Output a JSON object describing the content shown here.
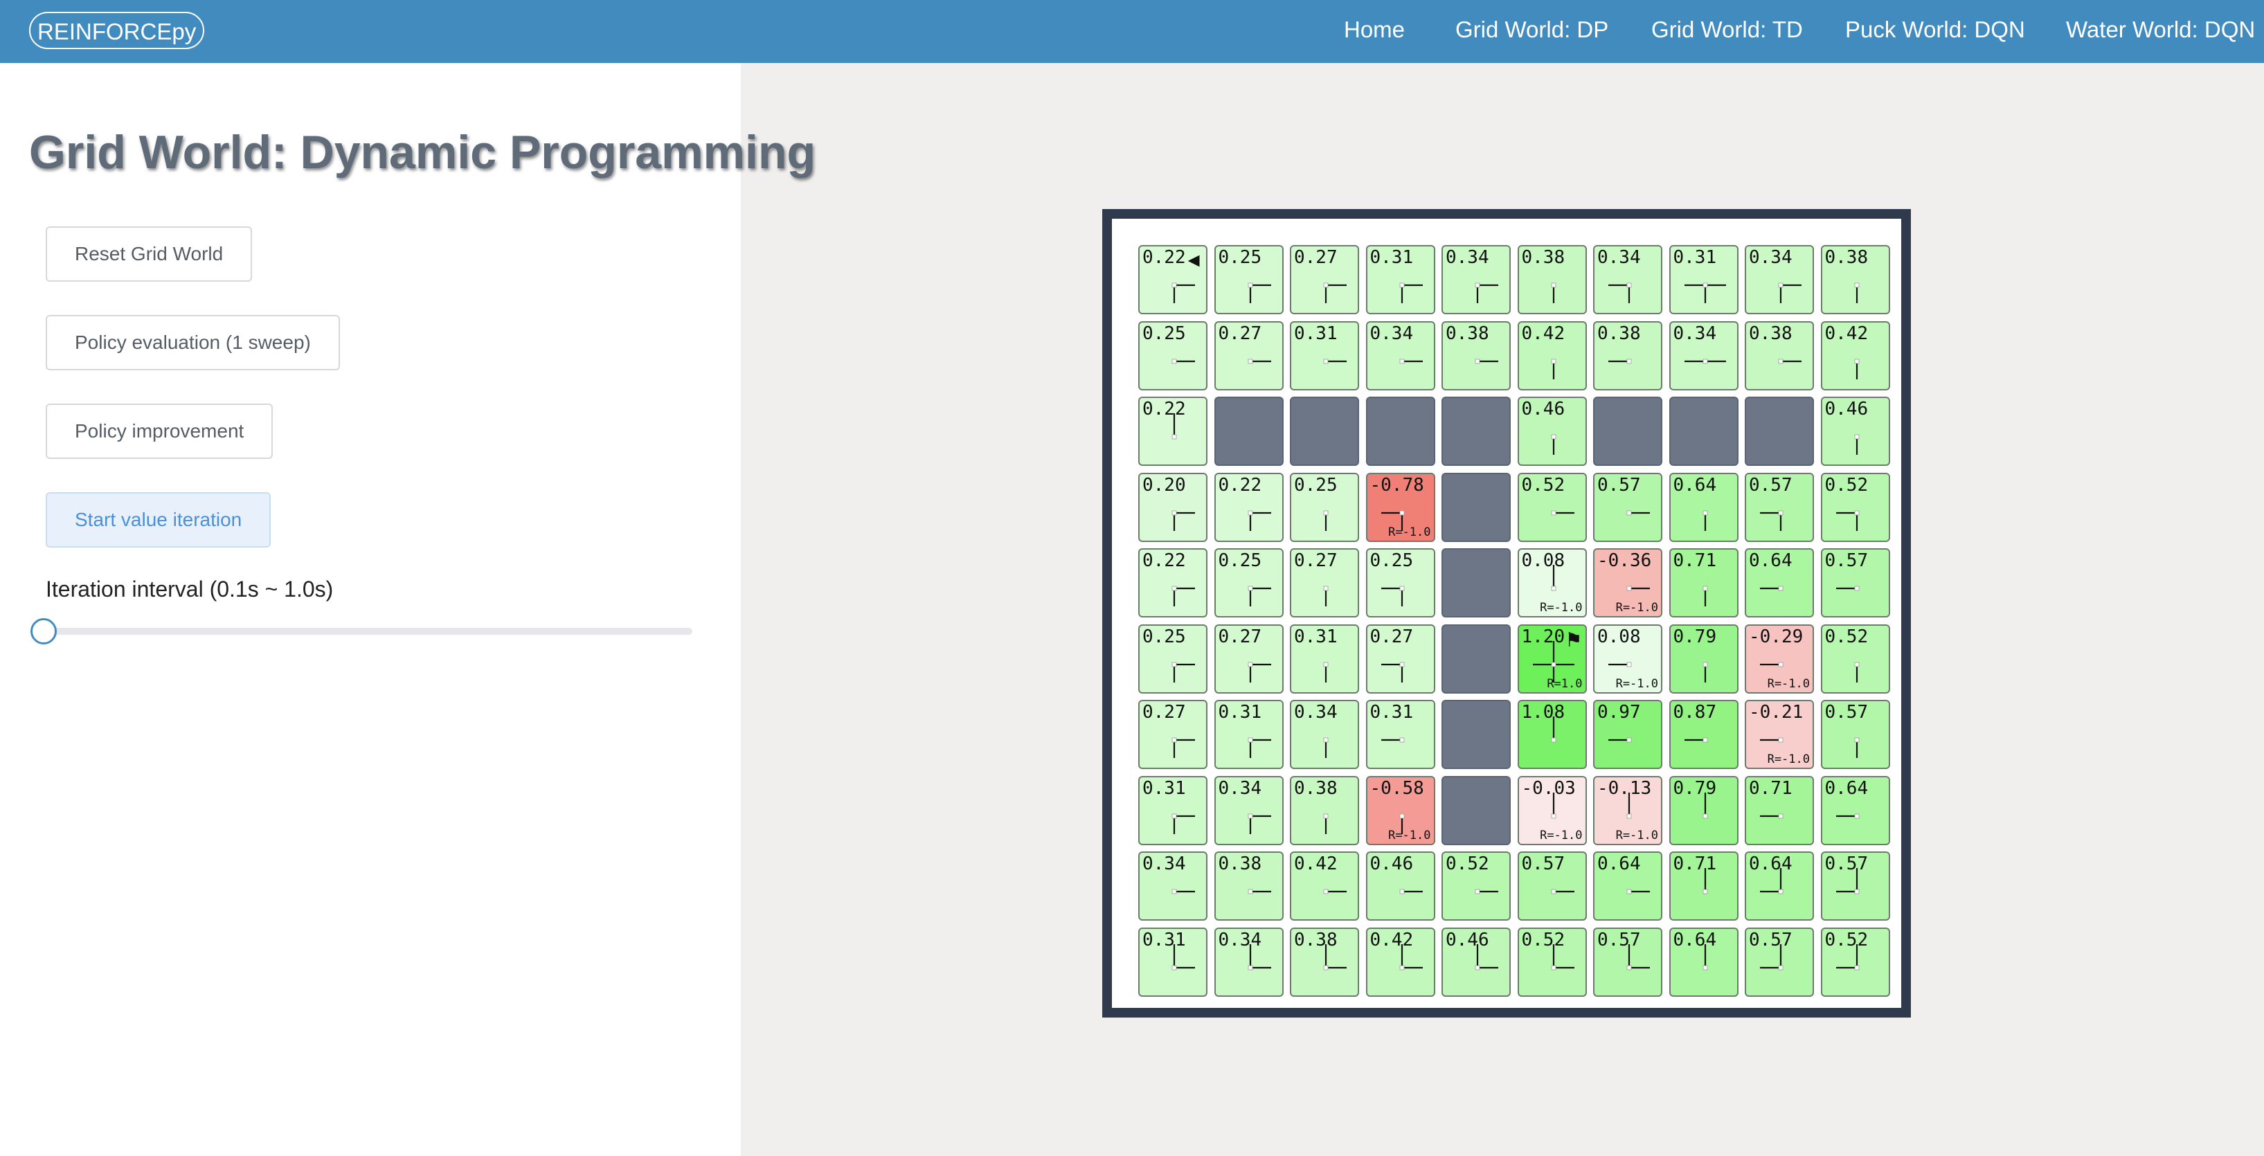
{
  "brand": "REINFORCEpy",
  "nav": [
    "Home",
    "Grid World: DP",
    "Grid World: TD",
    "Puck World: DQN",
    "Water World: DQN"
  ],
  "title": "Grid World: Dynamic Programming",
  "buttons": [
    "Reset Grid World",
    "Policy evaluation (1 sweep)",
    "Policy improvement",
    "Start value iteration"
  ],
  "interval_label": "Iteration interval (0.1s ~ 1.0s)",
  "slider_value": 0.1,
  "agent_icon": "agent-icon",
  "goal_icon": "goal-flag-icon",
  "grid": [
    [
      {
        "v": "0.22",
        "p": "ES",
        "agent": true
      },
      {
        "v": "0.25",
        "p": "ES"
      },
      {
        "v": "0.27",
        "p": "ES"
      },
      {
        "v": "0.31",
        "p": "ES"
      },
      {
        "v": "0.34",
        "p": "ES"
      },
      {
        "v": "0.38",
        "p": "S"
      },
      {
        "v": "0.34",
        "p": "WS"
      },
      {
        "v": "0.31",
        "p": "EWS"
      },
      {
        "v": "0.34",
        "p": "ES"
      },
      {
        "v": "0.38",
        "p": "S"
      }
    ],
    [
      {
        "v": "0.25",
        "p": "E"
      },
      {
        "v": "0.27",
        "p": "E"
      },
      {
        "v": "0.31",
        "p": "E"
      },
      {
        "v": "0.34",
        "p": "E"
      },
      {
        "v": "0.38",
        "p": "E"
      },
      {
        "v": "0.42",
        "p": "S"
      },
      {
        "v": "0.38",
        "p": "W"
      },
      {
        "v": "0.34",
        "p": "EW"
      },
      {
        "v": "0.38",
        "p": "E"
      },
      {
        "v": "0.42",
        "p": "S"
      }
    ],
    [
      {
        "v": "0.22",
        "p": "N"
      },
      {
        "wall": true
      },
      {
        "wall": true
      },
      {
        "wall": true
      },
      {
        "wall": true
      },
      {
        "v": "0.46",
        "p": "S"
      },
      {
        "wall": true
      },
      {
        "wall": true
      },
      {
        "wall": true
      },
      {
        "v": "0.46",
        "p": "S"
      }
    ],
    [
      {
        "v": "0.20",
        "p": "ES"
      },
      {
        "v": "0.22",
        "p": "ES"
      },
      {
        "v": "0.25",
        "p": "S"
      },
      {
        "v": "-0.78",
        "p": "WS",
        "r": "R=-1.0"
      },
      {
        "wall": true
      },
      {
        "v": "0.52",
        "p": "E"
      },
      {
        "v": "0.57",
        "p": "E"
      },
      {
        "v": "0.64",
        "p": "S"
      },
      {
        "v": "0.57",
        "p": "WS"
      },
      {
        "v": "0.52",
        "p": "WS"
      }
    ],
    [
      {
        "v": "0.22",
        "p": "ES"
      },
      {
        "v": "0.25",
        "p": "ES"
      },
      {
        "v": "0.27",
        "p": "S"
      },
      {
        "v": "0.25",
        "p": "WS"
      },
      {
        "wall": true
      },
      {
        "v": "0.08",
        "p": "N",
        "r": "R=-1.0"
      },
      {
        "v": "-0.36",
        "p": "E",
        "r": "R=-1.0"
      },
      {
        "v": "0.71",
        "p": "S"
      },
      {
        "v": "0.64",
        "p": "W"
      },
      {
        "v": "0.57",
        "p": "W"
      }
    ],
    [
      {
        "v": "0.25",
        "p": "ES"
      },
      {
        "v": "0.27",
        "p": "ES"
      },
      {
        "v": "0.31",
        "p": "S"
      },
      {
        "v": "0.27",
        "p": "WS"
      },
      {
        "wall": true
      },
      {
        "v": "1.20",
        "p": "NESW",
        "r": "R=1.0",
        "goal": true
      },
      {
        "v": "0.08",
        "p": "W",
        "r": "R=-1.0"
      },
      {
        "v": "0.79",
        "p": "S"
      },
      {
        "v": "-0.29",
        "p": "W",
        "r": "R=-1.0"
      },
      {
        "v": "0.52",
        "p": "S"
      }
    ],
    [
      {
        "v": "0.27",
        "p": "ES"
      },
      {
        "v": "0.31",
        "p": "ES"
      },
      {
        "v": "0.34",
        "p": "S"
      },
      {
        "v": "0.31",
        "p": "W"
      },
      {
        "wall": true
      },
      {
        "v": "1.08",
        "p": "N"
      },
      {
        "v": "0.97",
        "p": "W"
      },
      {
        "v": "0.87",
        "p": "W"
      },
      {
        "v": "-0.21",
        "p": "W",
        "r": "R=-1.0"
      },
      {
        "v": "0.57",
        "p": "S"
      }
    ],
    [
      {
        "v": "0.31",
        "p": "ES"
      },
      {
        "v": "0.34",
        "p": "ES"
      },
      {
        "v": "0.38",
        "p": "S"
      },
      {
        "v": "-0.58",
        "p": "S",
        "r": "R=-1.0"
      },
      {
        "wall": true
      },
      {
        "v": "-0.03",
        "p": "N",
        "r": "R=-1.0"
      },
      {
        "v": "-0.13",
        "p": "N",
        "r": "R=-1.0"
      },
      {
        "v": "0.79",
        "p": "N"
      },
      {
        "v": "0.71",
        "p": "W"
      },
      {
        "v": "0.64",
        "p": "W"
      }
    ],
    [
      {
        "v": "0.34",
        "p": "E"
      },
      {
        "v": "0.38",
        "p": "E"
      },
      {
        "v": "0.42",
        "p": "E"
      },
      {
        "v": "0.46",
        "p": "E"
      },
      {
        "v": "0.52",
        "p": "E"
      },
      {
        "v": "0.57",
        "p": "E"
      },
      {
        "v": "0.64",
        "p": "E"
      },
      {
        "v": "0.71",
        "p": "N"
      },
      {
        "v": "0.64",
        "p": "WN"
      },
      {
        "v": "0.57",
        "p": "WN"
      }
    ],
    [
      {
        "v": "0.31",
        "p": "EN"
      },
      {
        "v": "0.34",
        "p": "EN"
      },
      {
        "v": "0.38",
        "p": "EN"
      },
      {
        "v": "0.42",
        "p": "EN"
      },
      {
        "v": "0.46",
        "p": "EN"
      },
      {
        "v": "0.52",
        "p": "EN"
      },
      {
        "v": "0.57",
        "p": "EN"
      },
      {
        "v": "0.64",
        "p": "N"
      },
      {
        "v": "0.57",
        "p": "WN"
      },
      {
        "v": "0.52",
        "p": "WN"
      }
    ]
  ]
}
